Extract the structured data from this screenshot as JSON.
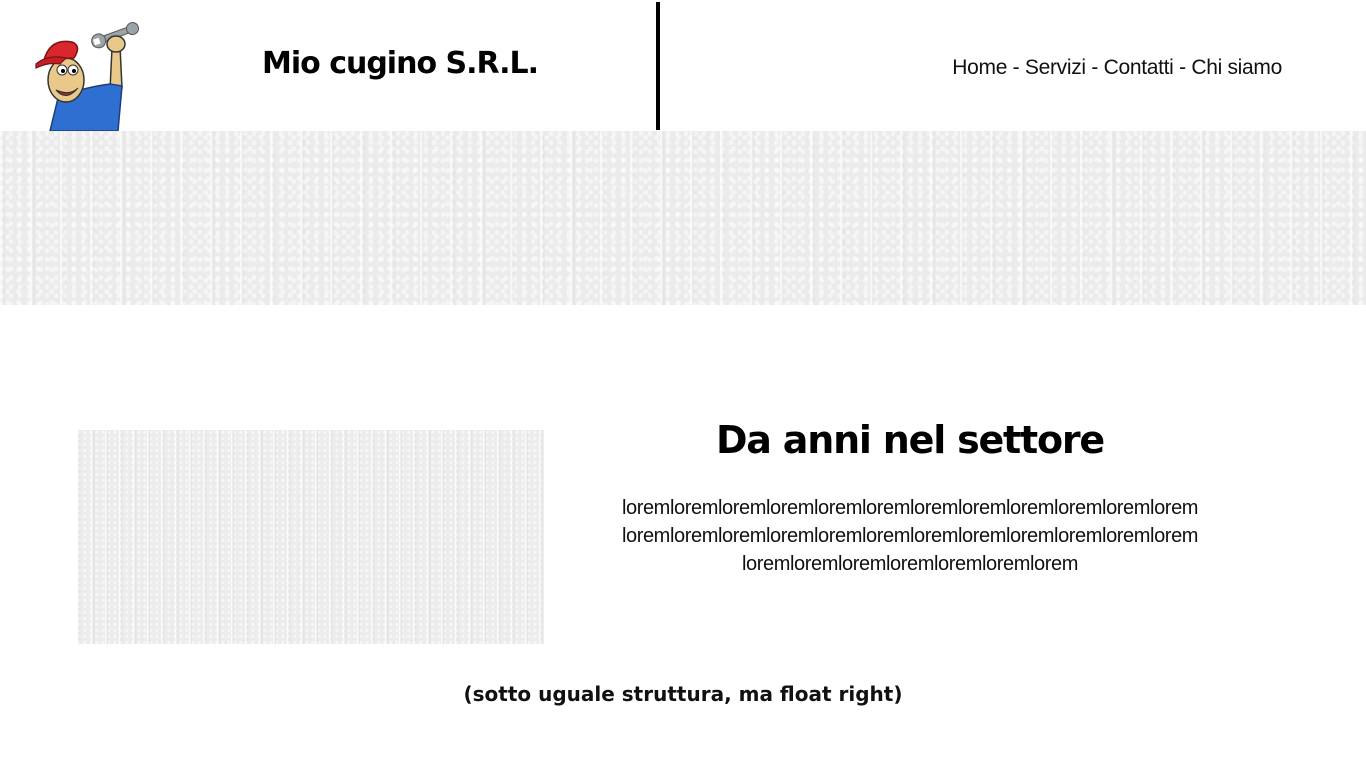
{
  "header": {
    "brand": "Mio cugino S.R.L.",
    "logo_icon": "mechanic-with-wrench-icon",
    "nav": {
      "home": "Home",
      "services": "Servizi",
      "contacts": "Contatti",
      "about": "Chi siamo",
      "separator": " - "
    }
  },
  "section": {
    "title": "Da anni nel settore",
    "text_lines": [
      "loremloremloremloremloremloremloremloremloremloremloremlorem",
      "loremloremloremloremloremloremloremloremloremloremloremlorem",
      "loremloremloremloremloremloremlorem"
    ]
  },
  "note": "(sotto uguale struttura, ma float right)"
}
